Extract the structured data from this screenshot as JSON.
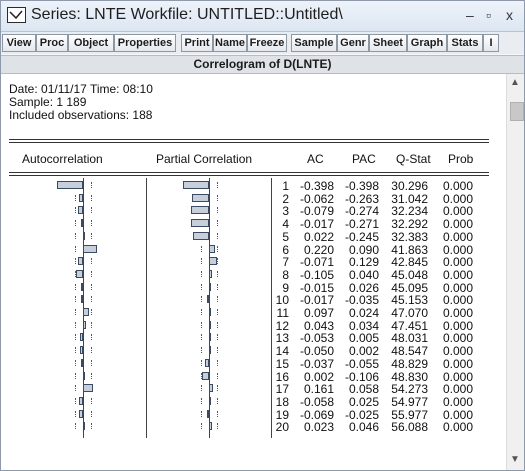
{
  "window": {
    "title": "Series: LNTE   Workfile: UNTITLED::Untitled\\",
    "minimize": "–",
    "maximize": "▫",
    "close": "x"
  },
  "toolbar": {
    "buttons": [
      "View",
      "Proc",
      "Object",
      "Properties",
      "Print",
      "Name",
      "Freeze",
      "Sample",
      "Genr",
      "Sheet",
      "Graph",
      "Stats",
      "I"
    ]
  },
  "view_caption": "Correlogram of D(LNTE)",
  "info": {
    "date_line": "Date: 01/11/17   Time: 08:10",
    "sample_line": "Sample: 1 189",
    "obs_line": "Included observations: 188"
  },
  "headers": [
    "Autocorrelation",
    "Partial Correlation",
    "AC",
    "PAC",
    "Q-Stat",
    "Prob"
  ],
  "rows": [
    {
      "lag": "1",
      "ac": "-0.398",
      "pac": "-0.398",
      "q": "30.296",
      "prob": "0.000"
    },
    {
      "lag": "2",
      "ac": "-0.062",
      "pac": "-0.263",
      "q": "31.042",
      "prob": "0.000"
    },
    {
      "lag": "3",
      "ac": "-0.079",
      "pac": "-0.274",
      "q": "32.234",
      "prob": "0.000"
    },
    {
      "lag": "4",
      "ac": "-0.017",
      "pac": "-0.271",
      "q": "32.292",
      "prob": "0.000"
    },
    {
      "lag": "5",
      "ac": "0.022",
      "pac": "-0.245",
      "q": "32.383",
      "prob": "0.000"
    },
    {
      "lag": "6",
      "ac": "0.220",
      "pac": "0.090",
      "q": "41.863",
      "prob": "0.000"
    },
    {
      "lag": "7",
      "ac": "-0.071",
      "pac": "0.129",
      "q": "42.845",
      "prob": "0.000"
    },
    {
      "lag": "8",
      "ac": "-0.105",
      "pac": "0.040",
      "q": "45.048",
      "prob": "0.000"
    },
    {
      "lag": "9",
      "ac": "-0.015",
      "pac": "0.026",
      "q": "45.095",
      "prob": "0.000"
    },
    {
      "lag": "10",
      "ac": "-0.017",
      "pac": "-0.035",
      "q": "45.153",
      "prob": "0.000"
    },
    {
      "lag": "11",
      "ac": "0.097",
      "pac": "0.024",
      "q": "47.070",
      "prob": "0.000"
    },
    {
      "lag": "12",
      "ac": "0.043",
      "pac": "0.034",
      "q": "47.451",
      "prob": "0.000"
    },
    {
      "lag": "13",
      "ac": "-0.053",
      "pac": "0.005",
      "q": "48.031",
      "prob": "0.000"
    },
    {
      "lag": "14",
      "ac": "-0.050",
      "pac": "0.002",
      "q": "48.547",
      "prob": "0.000"
    },
    {
      "lag": "15",
      "ac": "-0.037",
      "pac": "-0.055",
      "q": "48.829",
      "prob": "0.000"
    },
    {
      "lag": "16",
      "ac": "0.002",
      "pac": "-0.106",
      "q": "48.830",
      "prob": "0.000"
    },
    {
      "lag": "17",
      "ac": "0.161",
      "pac": "0.058",
      "q": "54.273",
      "prob": "0.000"
    },
    {
      "lag": "18",
      "ac": "-0.058",
      "pac": "0.025",
      "q": "54.977",
      "prob": "0.000"
    },
    {
      "lag": "19",
      "ac": "-0.069",
      "pac": "-0.025",
      "q": "55.977",
      "prob": "0.000"
    },
    {
      "lag": "20",
      "ac": "0.023",
      "pac": "0.046",
      "q": "56.088",
      "prob": "0.000"
    }
  ],
  "colors": {
    "bar_fill": "#c7cfdb",
    "bar_border": "#3b4b64",
    "caption_bg": "#dfe3e8"
  },
  "icons": {
    "window_icon": "series-graph-icon",
    "scroll_up": "chevron-up-icon",
    "scroll_down": "chevron-down-icon"
  }
}
